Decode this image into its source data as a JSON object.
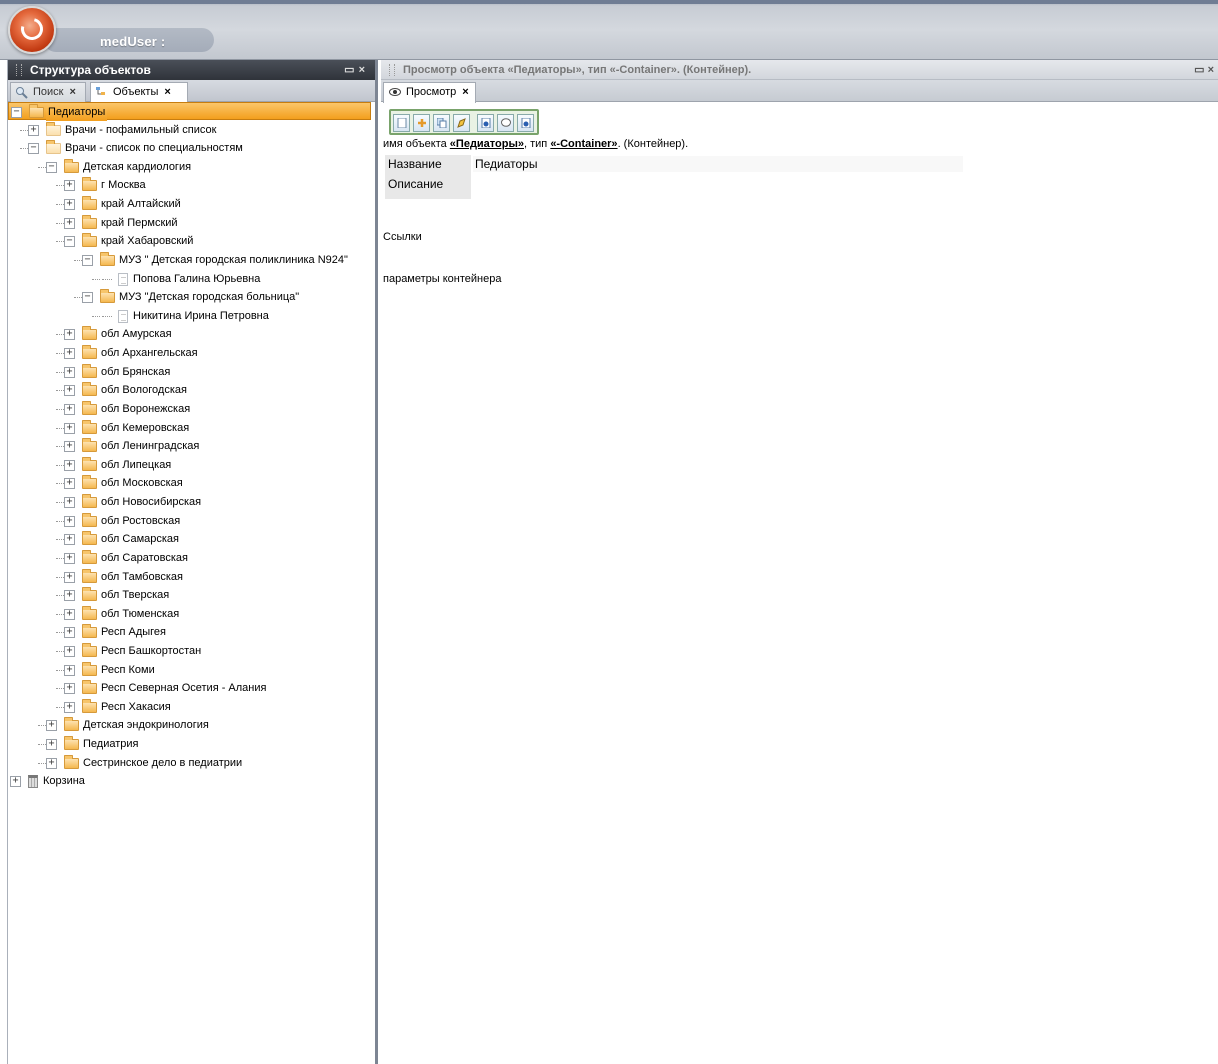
{
  "header": {
    "user_label": "medUser :"
  },
  "left_panel": {
    "title": "Структура объектов",
    "tabs": [
      {
        "label": "Поиск",
        "close": "×",
        "icon": "search-icon"
      },
      {
        "label": "Объекты",
        "close": "×",
        "icon": "tree-icon"
      }
    ],
    "tree": [
      {
        "label": "Педиаторы",
        "level": 0,
        "state": "expanded",
        "icon": "folder",
        "selected": true
      },
      {
        "label": "Врачи - пофамильный список",
        "level": 1,
        "state": "collapsed",
        "icon": "folder-pale"
      },
      {
        "label": "Врачи - список по специальностям",
        "level": 1,
        "state": "expanded",
        "icon": "folder-pale"
      },
      {
        "label": "Детская кардиология",
        "level": 2,
        "state": "expanded",
        "icon": "folder"
      },
      {
        "label": "г Москва",
        "level": 3,
        "state": "collapsed",
        "icon": "folder"
      },
      {
        "label": "край Алтайский",
        "level": 3,
        "state": "collapsed",
        "icon": "folder"
      },
      {
        "label": "край Пермский",
        "level": 3,
        "state": "collapsed",
        "icon": "folder"
      },
      {
        "label": "край Хабаровский",
        "level": 3,
        "state": "expanded",
        "icon": "folder"
      },
      {
        "label": "МУЗ \" Детская городская поликлиника N924\"",
        "level": 4,
        "state": "expanded",
        "icon": "folder"
      },
      {
        "label": "Попова Галина Юрьевна",
        "level": 5,
        "state": "leaf",
        "icon": "document"
      },
      {
        "label": "МУЗ \"Детская городская больница\"",
        "level": 4,
        "state": "expanded",
        "icon": "folder"
      },
      {
        "label": "Никитина Ирина Петровна",
        "level": 5,
        "state": "leaf",
        "icon": "document"
      },
      {
        "label": "обл Амурская",
        "level": 3,
        "state": "collapsed",
        "icon": "folder"
      },
      {
        "label": "обл Архангельская",
        "level": 3,
        "state": "collapsed",
        "icon": "folder"
      },
      {
        "label": "обл Брянская",
        "level": 3,
        "state": "collapsed",
        "icon": "folder"
      },
      {
        "label": "обл Вологодская",
        "level": 3,
        "state": "collapsed",
        "icon": "folder"
      },
      {
        "label": "обл Воронежская",
        "level": 3,
        "state": "collapsed",
        "icon": "folder"
      },
      {
        "label": "обл Кемеровская",
        "level": 3,
        "state": "collapsed",
        "icon": "folder"
      },
      {
        "label": "обл Ленинградская",
        "level": 3,
        "state": "collapsed",
        "icon": "folder"
      },
      {
        "label": "обл Липецкая",
        "level": 3,
        "state": "collapsed",
        "icon": "folder"
      },
      {
        "label": "обл Московская",
        "level": 3,
        "state": "collapsed",
        "icon": "folder"
      },
      {
        "label": "обл Новосибирская",
        "level": 3,
        "state": "collapsed",
        "icon": "folder"
      },
      {
        "label": "обл Ростовская",
        "level": 3,
        "state": "collapsed",
        "icon": "folder"
      },
      {
        "label": "обл Самарская",
        "level": 3,
        "state": "collapsed",
        "icon": "folder"
      },
      {
        "label": "обл Саратовская",
        "level": 3,
        "state": "collapsed",
        "icon": "folder"
      },
      {
        "label": "обл Тамбовская",
        "level": 3,
        "state": "collapsed",
        "icon": "folder"
      },
      {
        "label": "обл Тверская",
        "level": 3,
        "state": "collapsed",
        "icon": "folder"
      },
      {
        "label": "обл Тюменская",
        "level": 3,
        "state": "collapsed",
        "icon": "folder"
      },
      {
        "label": "Респ Адыгея",
        "level": 3,
        "state": "collapsed",
        "icon": "folder"
      },
      {
        "label": "Респ Башкортостан",
        "level": 3,
        "state": "collapsed",
        "icon": "folder"
      },
      {
        "label": "Респ Коми",
        "level": 3,
        "state": "collapsed",
        "icon": "folder"
      },
      {
        "label": "Респ Северная Осетия - Алания",
        "level": 3,
        "state": "collapsed",
        "icon": "folder"
      },
      {
        "label": "Респ Хакасия",
        "level": 3,
        "state": "collapsed",
        "icon": "folder"
      },
      {
        "label": "Детская эндокринология",
        "level": 2,
        "state": "collapsed",
        "icon": "folder"
      },
      {
        "label": "Педиатрия",
        "level": 2,
        "state": "collapsed",
        "icon": "folder"
      },
      {
        "label": "Сестринское дело в педиатрии",
        "level": 2,
        "state": "collapsed",
        "icon": "folder"
      },
      {
        "label": "Корзина",
        "level": 0,
        "state": "collapsed",
        "icon": "trash"
      }
    ]
  },
  "right_panel": {
    "title": "Просмотр объекта «Педиаторы», тип «-Container». (Контейнер).",
    "tab": {
      "label": "Просмотр",
      "close": "×",
      "icon": "eye-icon"
    },
    "toolbar_icons": [
      "new-icon",
      "add-icon",
      "copy-icon",
      "edit-icon",
      "info-icon",
      "comment-icon",
      "help-icon"
    ],
    "meta": {
      "prefix": "имя объекта ",
      "name": "«Педиаторы»",
      "middle": ", тип ",
      "type": "«-Container»",
      "suffix": ". (Контейнер)."
    },
    "properties": [
      {
        "label": "Название",
        "value": "Педиаторы"
      },
      {
        "label": "Описание",
        "value": ""
      }
    ],
    "links_label": "Ссылки",
    "container_params_label": "параметры контейнера"
  }
}
